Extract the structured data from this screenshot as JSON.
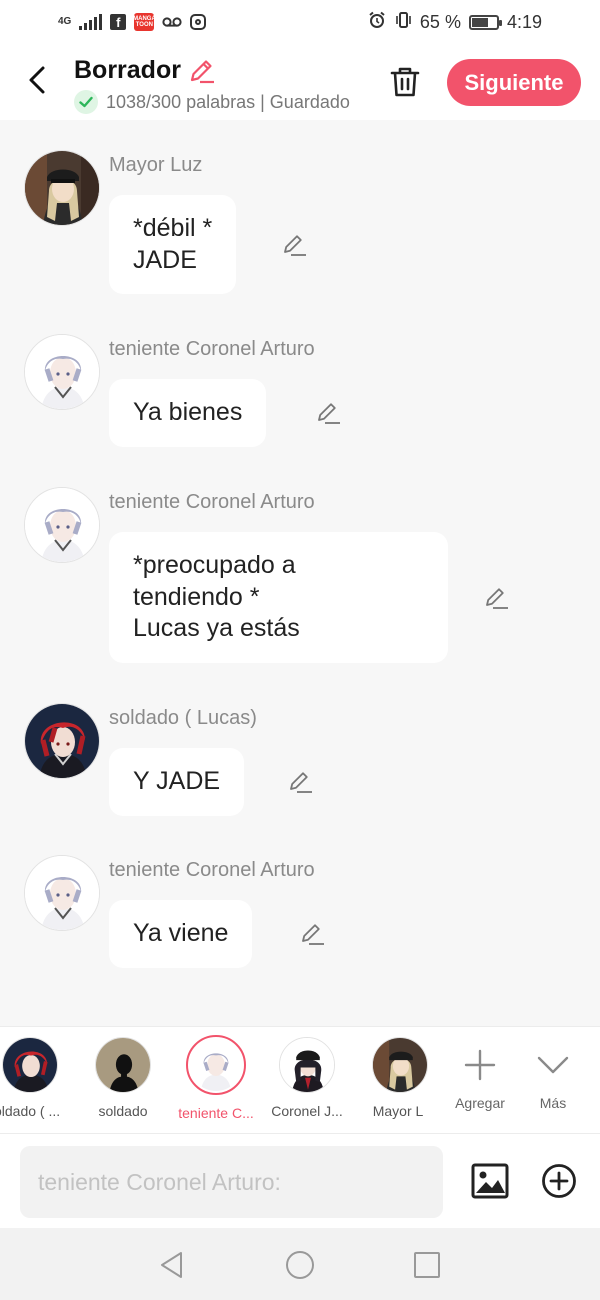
{
  "status_bar": {
    "network": "4G",
    "signal_icon": "signal-bars-icon",
    "app_icons": [
      "facebook-icon",
      "manga-app-icon",
      "voicemail-icon",
      "instagram-icon"
    ],
    "manga_icon_text": "MANGA TOON",
    "system_icons": [
      "alarm-icon",
      "vibrate-icon"
    ],
    "battery_percent": "65 %",
    "battery_level": 0.65,
    "time": "4:19"
  },
  "header": {
    "title": "Borrador",
    "word_count": "1038/300 palabras | Guardado",
    "next_label": "Siguiente",
    "accent_color": "#f2536b"
  },
  "messages": [
    {
      "sender": "Mayor Luz",
      "avatar": "mayor",
      "lines": [
        "*débil *",
        "JADE"
      ]
    },
    {
      "sender": "teniente Coronel Arturo",
      "avatar": "arturo",
      "lines": [
        "Ya bienes"
      ]
    },
    {
      "sender": "teniente Coronel Arturo",
      "avatar": "arturo",
      "lines": [
        "*preocupado a",
        "tendiendo *",
        "Lucas ya estás"
      ]
    },
    {
      "sender": "soldado ( Lucas)",
      "avatar": "lucas",
      "lines": [
        "Y JADE"
      ]
    },
    {
      "sender": "teniente Coronel Arturo",
      "avatar": "arturo",
      "lines": [
        "Ya viene"
      ]
    }
  ],
  "characters": [
    {
      "name": "oldado ( ...",
      "avatar": "lucas",
      "selected": false
    },
    {
      "name": "soldado",
      "avatar": "silhouette",
      "selected": false
    },
    {
      "name": "teniente C...",
      "avatar": "arturo",
      "selected": true
    },
    {
      "name": "Coronel J...",
      "avatar": "coronel",
      "selected": false
    },
    {
      "name": "Mayor L",
      "avatar": "mayor",
      "selected": false
    }
  ],
  "tools": {
    "add_label": "Agregar",
    "more_label": "Más"
  },
  "input": {
    "placeholder": "teniente Coronel Arturo:"
  },
  "navbar": {
    "icons": [
      "back-triangle-icon",
      "home-circle-icon",
      "recents-square-icon"
    ]
  }
}
